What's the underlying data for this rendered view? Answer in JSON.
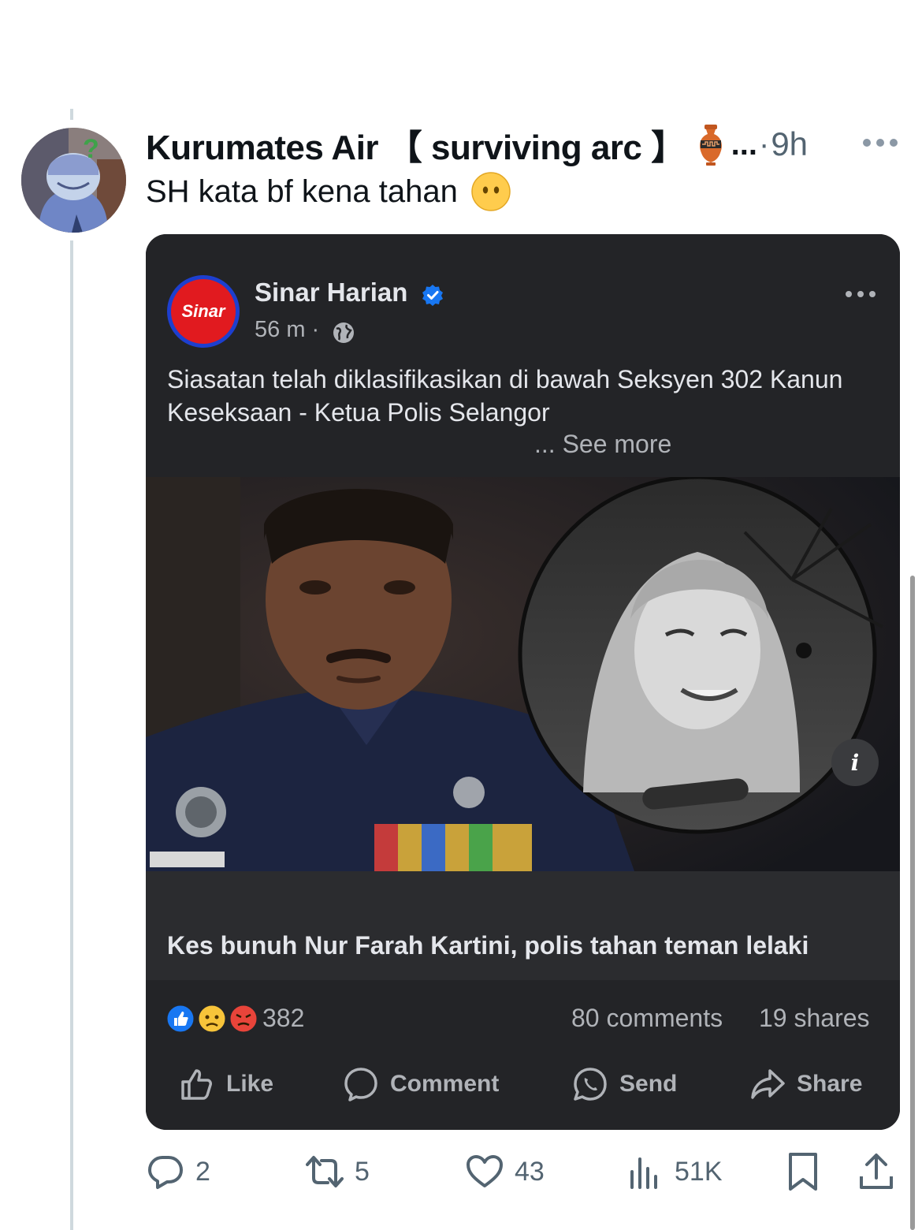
{
  "tweet": {
    "display_name": "Kurumates Air 【 surviving arc 】",
    "truncation": "...",
    "separator": "·",
    "time": "9h",
    "text": "SH kata bf kena tahan",
    "icons": [
      "amphora-emoji",
      "more-options-icon",
      "face-without-mouth-emoji"
    ]
  },
  "fb_post": {
    "page_name": "Sinar Harian",
    "logo_text": "Sinar",
    "time": "56 m ·",
    "body": "Siasatan telah diklasifikasikan di bawah Seksyen 302 Kanun Keseksaan - Ketua Polis Selangor",
    "see_more": "... See more",
    "info": "i",
    "headline": "Kes bunuh Nur Farah Kartini, polis tahan teman lelaki",
    "reaction_count": "382",
    "comments": "80 comments",
    "shares": "19 shares",
    "actions": {
      "like": "Like",
      "comment": "Comment",
      "send": "Send",
      "share": "Share"
    },
    "icons": [
      "verified-badge-icon",
      "globe-icon",
      "like-reaction-icon",
      "sad-reaction-icon",
      "angry-reaction-icon"
    ]
  },
  "tweet_actions": {
    "replies": "2",
    "reposts": "5",
    "likes": "43",
    "views": "51K"
  },
  "colors": {
    "text_primary": "#0f1419",
    "text_secondary": "#536471",
    "fb_dark": "#232427",
    "fb_text": "#e4e6eb",
    "fb_muted": "#b0b3b8",
    "verified_blue": "#1877f2",
    "thread_line": "#cfd9de"
  }
}
